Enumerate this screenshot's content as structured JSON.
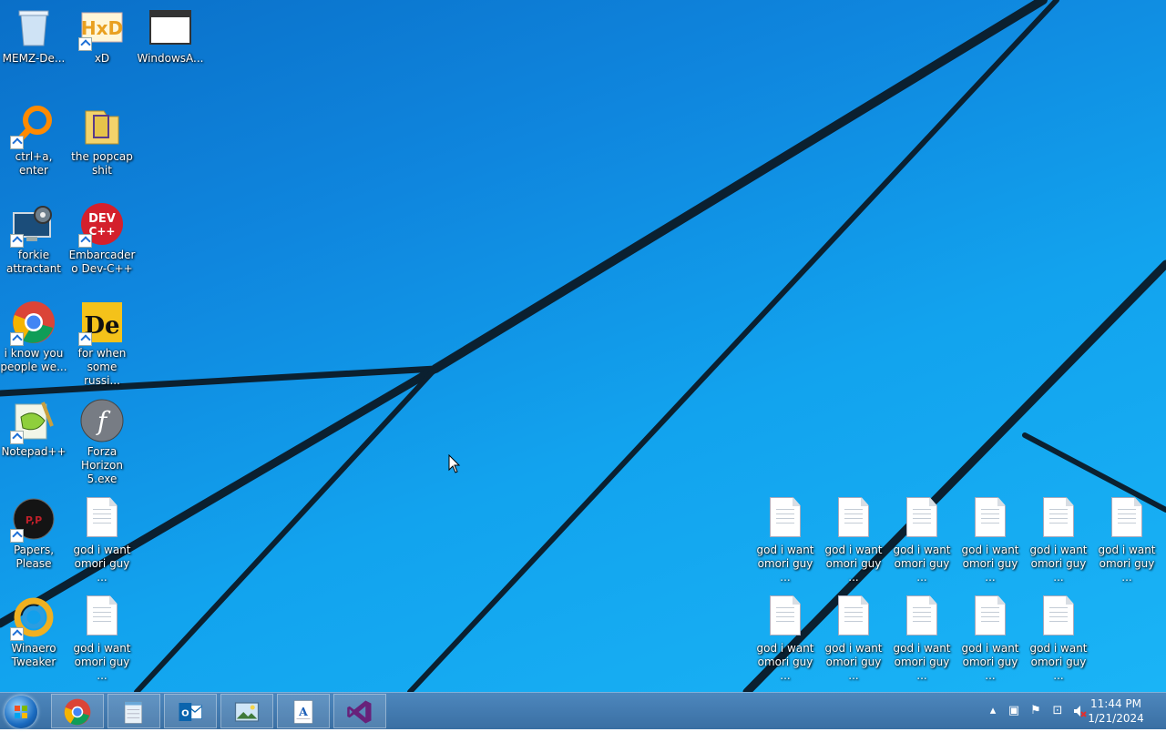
{
  "desktop": {
    "icons": [
      {
        "label": "MEMZ-De...",
        "icon": "recycle-bin-icon"
      },
      {
        "label": "xD",
        "icon": "hxd-hex-editor-icon"
      },
      {
        "label": "WindowsA...",
        "icon": "window-app-icon"
      },
      {
        "label": "ctrl+a, enter",
        "icon": "search-magnifier-icon"
      },
      {
        "label": "the popcap shit",
        "icon": "folder-icon"
      },
      {
        "label": "forkie attractant",
        "icon": "computer-settings-icon"
      },
      {
        "label": "Embarcadero Dev-C++",
        "icon": "devcpp-icon"
      },
      {
        "label": "i know you people we...",
        "icon": "chrome-icon"
      },
      {
        "label": "for when some russi...",
        "icon": "de-app-icon"
      },
      {
        "label": "Notepad++",
        "icon": "notepadpp-icon"
      },
      {
        "label": "Forza Horizon 5.exe",
        "icon": "flash-icon"
      },
      {
        "label": "Papers, Please",
        "icon": "papers-please-icon"
      },
      {
        "label": "god i want omori guy ...",
        "icon": "text-document-icon"
      },
      {
        "label": "Winaero Tweaker",
        "icon": "winaero-icon"
      },
      {
        "label": "god i want omori guy ...",
        "icon": "text-document-icon"
      }
    ],
    "doc_grid": [
      {
        "label": "god i want omori guy ..."
      },
      {
        "label": "god i want omori guy ..."
      },
      {
        "label": "god i want omori guy ..."
      },
      {
        "label": "god i want omori guy ..."
      },
      {
        "label": "god i want omori guy ..."
      },
      {
        "label": "god i want omori guy ..."
      },
      {
        "label": "god i want omori guy ..."
      },
      {
        "label": "god i want omori guy ..."
      },
      {
        "label": "god i want omori guy ..."
      },
      {
        "label": "god i want omori guy ..."
      },
      {
        "label": "god i want omori guy ..."
      }
    ]
  },
  "taskbar": {
    "pinned": [
      {
        "icon": "chrome-icon"
      },
      {
        "icon": "notepad-icon"
      },
      {
        "icon": "outlook-icon"
      },
      {
        "icon": "photo-viewer-icon"
      },
      {
        "icon": "wordpad-icon"
      },
      {
        "icon": "visual-studio-icon"
      }
    ],
    "tray": [
      "show-hidden-icons-icon",
      "network-flyout-icon",
      "action-center-flag-icon",
      "network-icon",
      "volume-muted-icon"
    ],
    "clock": {
      "time": "11:44 PM",
      "date": "1/21/2024"
    }
  },
  "colors": {
    "wallpaper": "#12a3ee",
    "taskbar": "#3f76aa"
  }
}
